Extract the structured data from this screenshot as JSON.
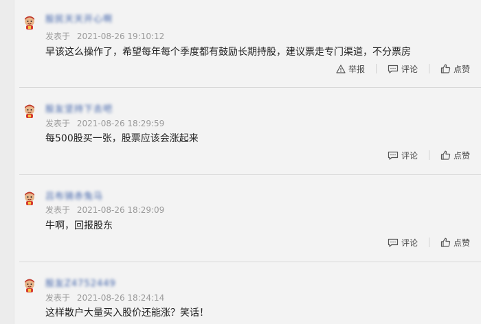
{
  "comments": [
    {
      "username": "股民天天开心啊",
      "prefix": "发表于",
      "time": "2021-08-26 19:10:12",
      "content": "早该这么操作了，希望每年每个季度都有鼓励长期持股，建议票走专门渠道，不分票房",
      "report": "举报",
      "comment": "评论",
      "like": "点赞"
    },
    {
      "username": "股友坚持下去吧",
      "prefix": "发表于",
      "time": "2021-08-26 18:29:59",
      "content": "每500股买一张，股票应该会涨起来",
      "comment": "评论",
      "like": "点赞"
    },
    {
      "username": "吕布骑赤兔马",
      "prefix": "发表于",
      "time": "2021-08-26 18:29:09",
      "content": "牛啊，回报股东",
      "comment": "评论",
      "like": "点赞"
    },
    {
      "username": "股友Z4752449",
      "prefix": "发表于",
      "time": "2021-08-26 18:24:14",
      "content": "这样散户大量买入股价还能涨？笑话！"
    }
  ],
  "colors": {
    "username": "#3a5ea8",
    "meta": "#9a9a9a",
    "text": "#222222",
    "background": "#f3f3f3"
  },
  "icons": [
    "avatar-mascot",
    "report-icon",
    "comment-icon",
    "like-icon"
  ]
}
